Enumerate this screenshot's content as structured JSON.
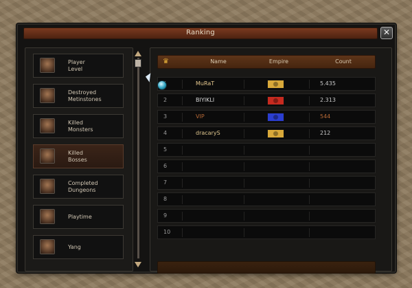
{
  "window": {
    "title": "Ranking",
    "close_symbol": "✕"
  },
  "categories": [
    {
      "label": "Player\nLevel",
      "icon": "player-level-icon",
      "active": false
    },
    {
      "label": "Destroyed\nMetinstones",
      "icon": "metinstone-icon",
      "active": false
    },
    {
      "label": "Killed\nMonsters",
      "icon": "monster-icon",
      "active": false
    },
    {
      "label": "Killed\nBosses",
      "icon": "boss-icon",
      "active": true
    },
    {
      "label": "Completed\nDungeons",
      "icon": "dungeon-icon",
      "active": false
    },
    {
      "label": "Playtime",
      "icon": "playtime-icon",
      "active": false
    },
    {
      "label": "Yang",
      "icon": "yang-icon",
      "active": false
    }
  ],
  "table": {
    "headers": {
      "rank_icon": "crown-icon",
      "name": "Name",
      "empire": "Empire",
      "count": "Count"
    },
    "rows": [
      {
        "rank": "1",
        "name": "MuRaT",
        "empire_color": "#d9a93a",
        "count": "5.435",
        "name_color": "#e7c98f"
      },
      {
        "rank": "2",
        "name": "BIYIKLI",
        "empire_color": "#c62a1f",
        "count": "2.313",
        "name_color": "#d8d8d8"
      },
      {
        "rank": "3",
        "name": "VIP",
        "empire_color": "#2b3ed0",
        "count": "544",
        "name_color": "#b96a36"
      },
      {
        "rank": "4",
        "name": "dracaryS",
        "empire_color": "#d9a93a",
        "count": "212",
        "name_color": "#e0c78f"
      },
      {
        "rank": "5",
        "name": "",
        "empire_color": "",
        "count": "",
        "name_color": ""
      },
      {
        "rank": "6",
        "name": "",
        "empire_color": "",
        "count": "",
        "name_color": ""
      },
      {
        "rank": "7",
        "name": "",
        "empire_color": "",
        "count": "",
        "name_color": ""
      },
      {
        "rank": "8",
        "name": "",
        "empire_color": "",
        "count": "",
        "name_color": ""
      },
      {
        "rank": "9",
        "name": "",
        "empire_color": "",
        "count": "",
        "name_color": ""
      },
      {
        "rank": "10",
        "name": "",
        "empire_color": "",
        "count": "",
        "name_color": ""
      }
    ]
  },
  "colors": {
    "title_bar": "#6a3119",
    "header_bar": "#5e3519",
    "active_category": "#3b2418"
  }
}
